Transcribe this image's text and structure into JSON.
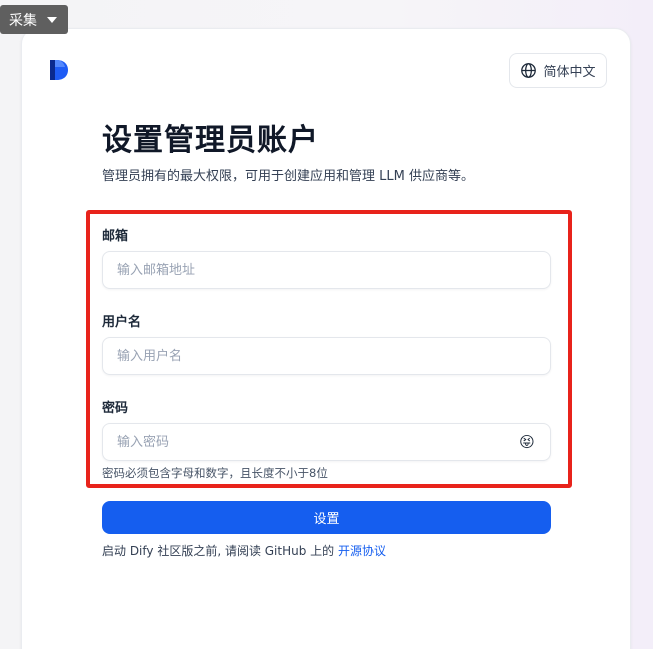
{
  "toolbar": {
    "collect_label": "采集"
  },
  "header": {
    "language_label": "简体中文"
  },
  "main": {
    "title": "设置管理员账户",
    "subtitle": "管理员拥有的最大权限，可用于创建应用和管理 LLM 供应商等。",
    "email": {
      "label": "邮箱",
      "placeholder": "输入邮箱地址",
      "value": ""
    },
    "username": {
      "label": "用户名",
      "placeholder": "输入用户名",
      "value": ""
    },
    "password": {
      "label": "密码",
      "placeholder": "输入密码",
      "value": "",
      "toggle_icon": "😝",
      "hint": "密码必须包含字母和数字，且长度不小于8位"
    },
    "submit_label": "设置",
    "footer": {
      "prefix": "启动 Dify 社区版之前, 请阅读 GitHub 上的 ",
      "link": "开源协议"
    }
  },
  "colors": {
    "accent": "#155eef",
    "highlight_border": "#e8231b",
    "logo": "#155eef"
  }
}
